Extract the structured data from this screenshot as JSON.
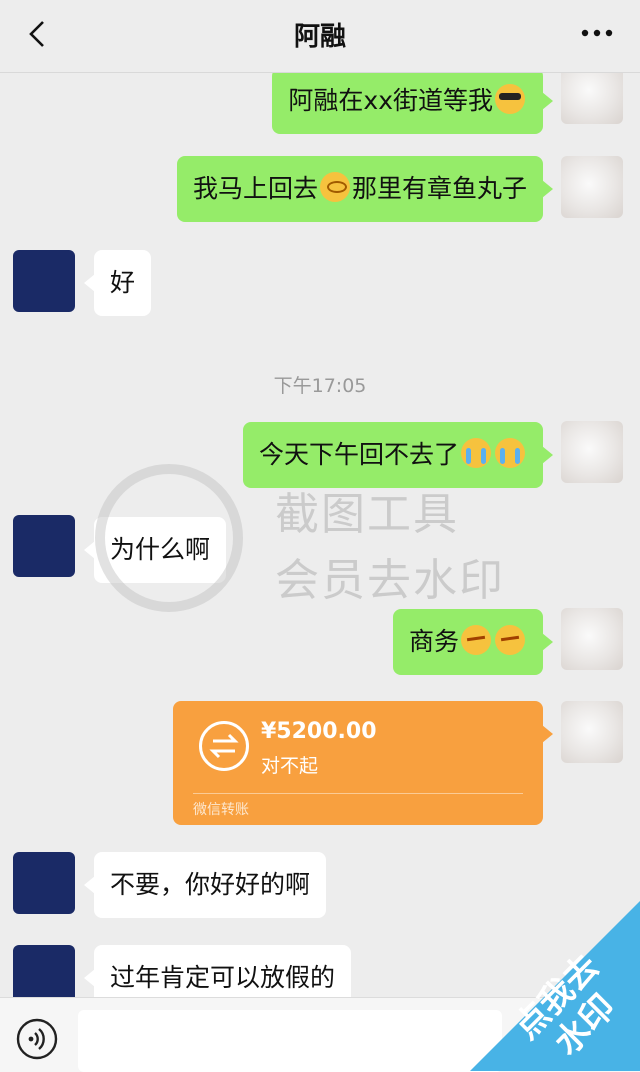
{
  "header": {
    "title": "阿融"
  },
  "messages": [
    {
      "side": "me",
      "parts": [
        "阿融在xx街道等我"
      ],
      "emoji": [
        "sunglasses-emoji"
      ]
    },
    {
      "side": "me",
      "parts": [
        "我马上回去",
        "那里有章鱼丸子"
      ],
      "emoji": [
        "dizzy-face-emoji"
      ]
    },
    {
      "side": "other",
      "parts": [
        "好"
      ]
    },
    {
      "side": "me",
      "parts": [
        "今天下午回不去了"
      ],
      "emoji": [
        "crying-emoji",
        "crying-emoji"
      ]
    },
    {
      "side": "other",
      "parts": [
        "为什么啊"
      ]
    },
    {
      "side": "me",
      "parts": [
        "商务"
      ],
      "emoji": [
        "angry-emoji",
        "angry-emoji"
      ]
    },
    {
      "side": "other",
      "parts": [
        "不要，你好好的啊"
      ]
    },
    {
      "side": "other",
      "parts": [
        "过年肯定可以放假的"
      ]
    }
  ],
  "timestamp": "下午17:05",
  "transfer": {
    "amount": "¥5200.00",
    "note": "对不起",
    "label": "微信转账"
  },
  "watermark": {
    "line1": "截图工具",
    "line2": "会员去水印"
  },
  "corner_badge": {
    "text": "点我去水印",
    "color": "#48b3e6"
  },
  "colors": {
    "my_bubble": "#95ec69",
    "other_bubble": "#ffffff",
    "transfer": "#f8a03f",
    "background": "#ededed"
  }
}
